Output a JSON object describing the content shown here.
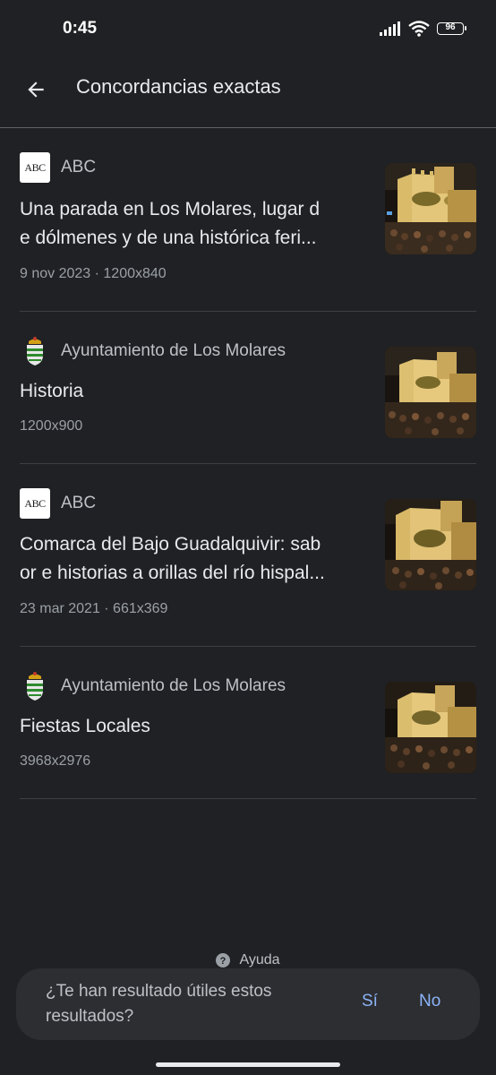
{
  "status_bar": {
    "time": "0:45",
    "battery": "96"
  },
  "app_bar": {
    "title": "Concordancias exactas"
  },
  "results": [
    {
      "source": "ABC",
      "source_logo": "abc-logo",
      "title": "Una parada en Los Molares, lugar de dólmenes y de una histórica feri...",
      "title_line1": "Una parada en Los Molares, lugar d",
      "title_line2": "e dólmenes y de una histórica feri...",
      "meta": "9 nov 2023 · 1200x840"
    },
    {
      "source": "Ayuntamiento de Los Molares",
      "source_logo": "coat-of-arms",
      "title": "Historia",
      "meta": "1200x900"
    },
    {
      "source": "ABC",
      "source_logo": "abc-logo",
      "title": "Comarca del Bajo Guadalquivir: sabor e historias a orillas del río hispal...",
      "title_line1": "Comarca del Bajo Guadalquivir: sab",
      "title_line2": "or e historias a orillas del río hispal...",
      "meta": "23 mar 2021 · 661x369"
    },
    {
      "source": "Ayuntamiento de Los Molares",
      "source_logo": "coat-of-arms",
      "title": "Fiestas Locales",
      "meta": "3968x2976"
    }
  ],
  "abc_logo_text": "ABC",
  "help": {
    "label": "Ayuda"
  },
  "feedback": {
    "question": "¿Te han resultado útiles estos resultados?",
    "yes": "Sí",
    "no": "No"
  },
  "colors": {
    "background": "#202124",
    "accent": "#8ab4f8",
    "text": "#e8eaed",
    "muted": "#9aa0a6"
  }
}
